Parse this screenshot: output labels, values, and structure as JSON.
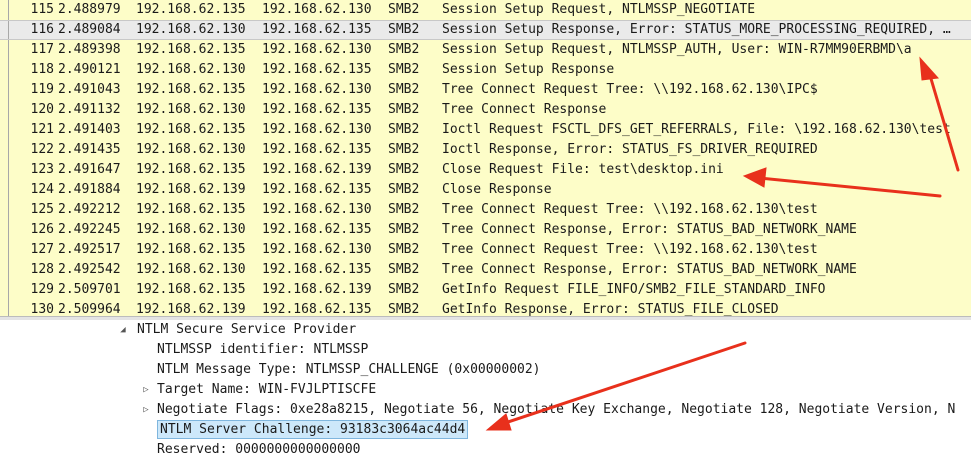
{
  "packet_list": {
    "rows": [
      {
        "no": "115",
        "time": "2.488979",
        "src": "192.168.62.135",
        "dst": "192.168.62.130",
        "proto": "SMB2",
        "info": "Session Setup Request, NTLMSSP_NEGOTIATE"
      },
      {
        "no": "116",
        "time": "2.489084",
        "src": "192.168.62.130",
        "dst": "192.168.62.135",
        "proto": "SMB2",
        "info": "Session Setup Response, Error: STATUS_MORE_PROCESSING_REQUIRED, …"
      },
      {
        "no": "117",
        "time": "2.489398",
        "src": "192.168.62.135",
        "dst": "192.168.62.130",
        "proto": "SMB2",
        "info": "Session Setup Request, NTLMSSP_AUTH, User: WIN-R7MM90ERBMD\\a"
      },
      {
        "no": "118",
        "time": "2.490121",
        "src": "192.168.62.130",
        "dst": "192.168.62.135",
        "proto": "SMB2",
        "info": "Session Setup Response"
      },
      {
        "no": "119",
        "time": "2.491043",
        "src": "192.168.62.135",
        "dst": "192.168.62.130",
        "proto": "SMB2",
        "info": "Tree Connect Request Tree: \\\\192.168.62.130\\IPC$"
      },
      {
        "no": "120",
        "time": "2.491132",
        "src": "192.168.62.130",
        "dst": "192.168.62.135",
        "proto": "SMB2",
        "info": "Tree Connect Response"
      },
      {
        "no": "121",
        "time": "2.491403",
        "src": "192.168.62.135",
        "dst": "192.168.62.130",
        "proto": "SMB2",
        "info": "Ioctl Request FSCTL_DFS_GET_REFERRALS, File: \\192.168.62.130\\test"
      },
      {
        "no": "122",
        "time": "2.491435",
        "src": "192.168.62.130",
        "dst": "192.168.62.135",
        "proto": "SMB2",
        "info": "Ioctl Response, Error: STATUS_FS_DRIVER_REQUIRED"
      },
      {
        "no": "123",
        "time": "2.491647",
        "src": "192.168.62.135",
        "dst": "192.168.62.139",
        "proto": "SMB2",
        "info": "Close Request File: test\\desktop.ini"
      },
      {
        "no": "124",
        "time": "2.491884",
        "src": "192.168.62.139",
        "dst": "192.168.62.135",
        "proto": "SMB2",
        "info": "Close Response"
      },
      {
        "no": "125",
        "time": "2.492212",
        "src": "192.168.62.135",
        "dst": "192.168.62.130",
        "proto": "SMB2",
        "info": "Tree Connect Request Tree: \\\\192.168.62.130\\test"
      },
      {
        "no": "126",
        "time": "2.492245",
        "src": "192.168.62.130",
        "dst": "192.168.62.135",
        "proto": "SMB2",
        "info": "Tree Connect Response, Error: STATUS_BAD_NETWORK_NAME"
      },
      {
        "no": "127",
        "time": "2.492517",
        "src": "192.168.62.135",
        "dst": "192.168.62.130",
        "proto": "SMB2",
        "info": "Tree Connect Request Tree: \\\\192.168.62.130\\test"
      },
      {
        "no": "128",
        "time": "2.492542",
        "src": "192.168.62.130",
        "dst": "192.168.62.135",
        "proto": "SMB2",
        "info": "Tree Connect Response, Error: STATUS_BAD_NETWORK_NAME"
      },
      {
        "no": "129",
        "time": "2.509701",
        "src": "192.168.62.135",
        "dst": "192.168.62.139",
        "proto": "SMB2",
        "info": "GetInfo Request FILE_INFO/SMB2_FILE_STANDARD_INFO"
      },
      {
        "no": "130",
        "time": "2.509964",
        "src": "192.168.62.139",
        "dst": "192.168.62.135",
        "proto": "SMB2",
        "info": "GetInfo Response, Error: STATUS_FILE_CLOSED"
      }
    ],
    "selected_no": "116"
  },
  "details": {
    "section_header": "NTLM Secure Service Provider",
    "items": [
      {
        "text": "NTLMSSP identifier: NTLMSSP",
        "expandable": false
      },
      {
        "text": "NTLM Message Type: NTLMSSP_CHALLENGE (0x00000002)",
        "expandable": false
      },
      {
        "text": "Target Name: WIN-FVJLPTISCFE",
        "expandable": true
      },
      {
        "text": "Negotiate Flags: 0xe28a8215, Negotiate 56, Negotiate Key Exchange, Negotiate 128, Negotiate Version, N",
        "expandable": true
      },
      {
        "text": "NTLM Server Challenge: 93183c3064ac44d4",
        "expandable": false,
        "highlighted": true
      },
      {
        "text": "Reserved: 0000000000000000",
        "expandable": false
      }
    ]
  },
  "icons": {
    "expanded": "triangle-down-icon",
    "collapsed": "triangle-right-icon"
  },
  "colors": {
    "packet_row_bg": "#fdfdc8",
    "selected_row_bg": "#eaeaea",
    "highlight_bg": "#cde8fa",
    "annotation_arrow": "#e8301c"
  }
}
